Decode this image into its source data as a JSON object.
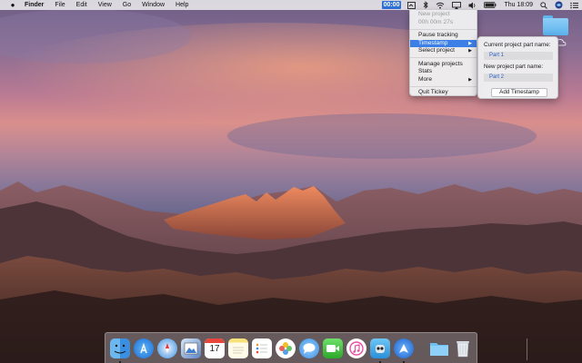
{
  "menubar": {
    "apple_icon": "apple-icon",
    "app_name": "Finder",
    "menus": [
      "File",
      "Edit",
      "View",
      "Go",
      "Window",
      "Help"
    ],
    "timer_display": "00:00",
    "clock": "Thu 18:09"
  },
  "dropdown": {
    "project_name": "New project",
    "elapsed": "00h 00m 27s",
    "pause": "Pause tracking",
    "timestamp": "Timestamp",
    "select_project": "Select project",
    "manage_projects": "Manage projects",
    "stats": "Stats",
    "more": "More",
    "quit": "Quit Tickey"
  },
  "submenu": {
    "current_label": "Current project part name:",
    "current_value": "Part 1",
    "new_label": "New project part name:",
    "new_value": "Part 2",
    "button": "Add Timestamp"
  },
  "dock": {
    "items": [
      "finder-icon",
      "app-store-icon",
      "safari-icon",
      "preview-icon",
      "calendar-icon",
      "notes-icon",
      "reminders-icon",
      "photos-icon",
      "messages-icon",
      "facetime-icon",
      "itunes-icon",
      "tweetbot-icon",
      "migration-icon",
      "folder-icon",
      "trash-icon"
    ],
    "calendar_day": "17"
  },
  "colors": {
    "highlight": "#3c7fe6",
    "timer_chip": "#2f6fd6",
    "field_text": "#2a5fc0"
  }
}
